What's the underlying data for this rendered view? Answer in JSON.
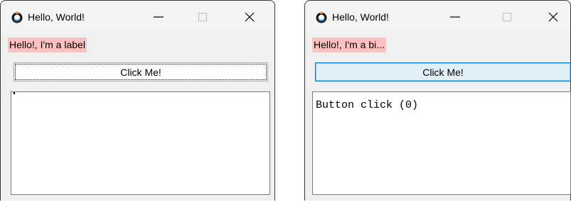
{
  "colors": {
    "label_bg": "#ffc0c0",
    "focused_button_border": "#0078d4",
    "focused_button_bg": "#e1eff9"
  },
  "windows": [
    {
      "title": "Hello, World!",
      "label": "Hello!, I'm a label",
      "button_label": "Click Me!",
      "textbox_value": ""
    },
    {
      "title": "Hello, World!",
      "label": "Hello!, I'm a bi...",
      "button_label": "Click Me!",
      "textbox_value": "Button click (0)"
    }
  ],
  "icons": {
    "app": "app-icon",
    "minimize": "minimize-icon",
    "maximize": "maximize-icon",
    "close": "close-icon"
  }
}
